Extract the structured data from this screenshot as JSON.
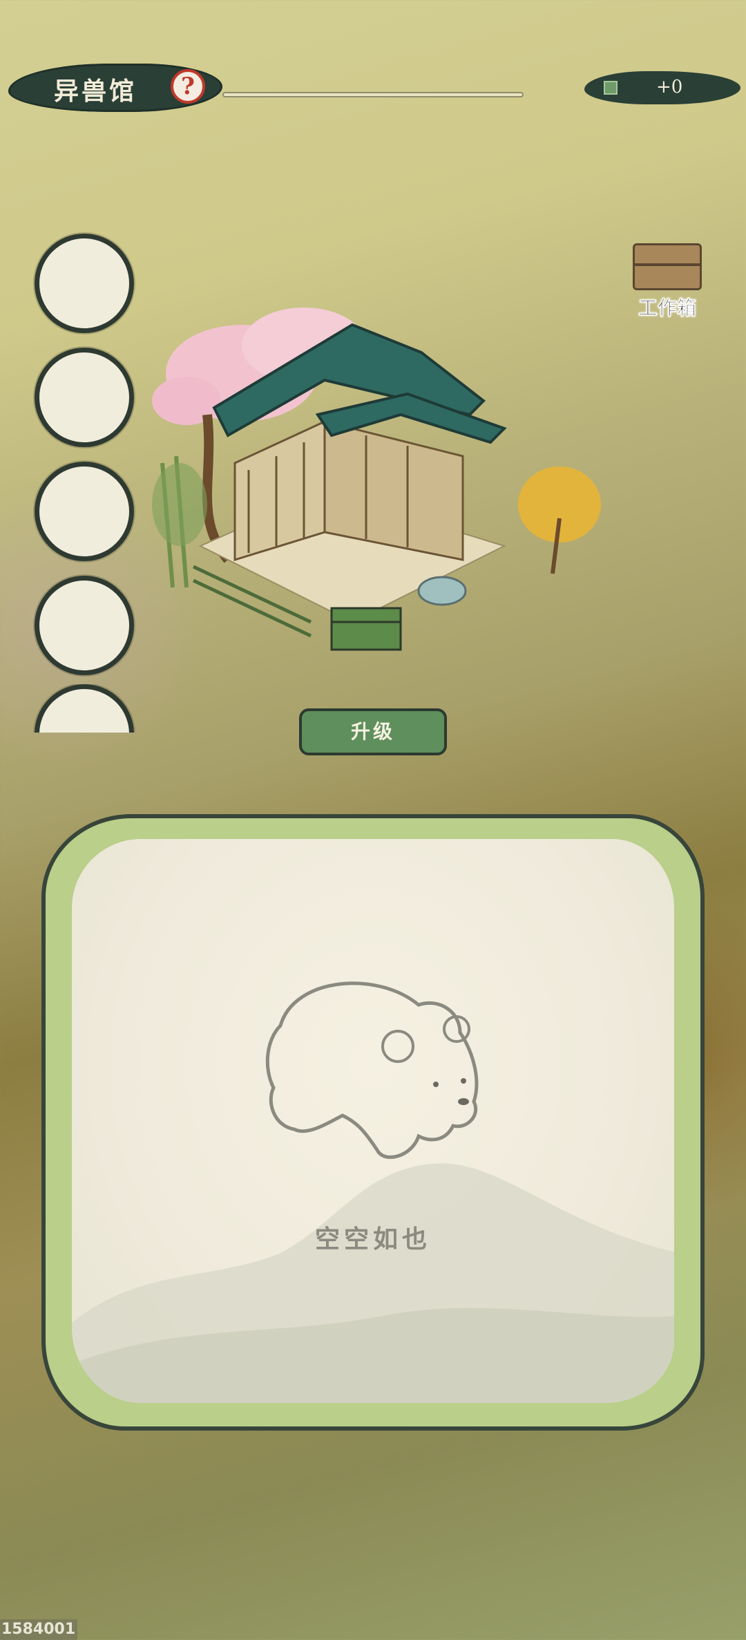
{
  "header": {
    "title": "异兽馆",
    "help_icon": "question-mark-icon",
    "progress": 0,
    "currency_icon": "flag-coin-icon",
    "currency_value": "+0"
  },
  "side_slots": {
    "count": 5,
    "state": "empty"
  },
  "toolbox": {
    "icon": "wooden-crate-icon",
    "label": "工作箱"
  },
  "building": {
    "icon": "pavilion-illustration"
  },
  "upgrade_button": {
    "label": "升级"
  },
  "panel": {
    "empty_label": "空空如也",
    "illustration": "bear-sketch"
  },
  "footer": {
    "build_id": "1584001"
  },
  "colors": {
    "ink_dark": "#2a3f36",
    "button_green": "#5f8f5c",
    "panel_frame": "#b9cf8a",
    "paper": "#f1eddd",
    "help_red": "#c0392b"
  }
}
